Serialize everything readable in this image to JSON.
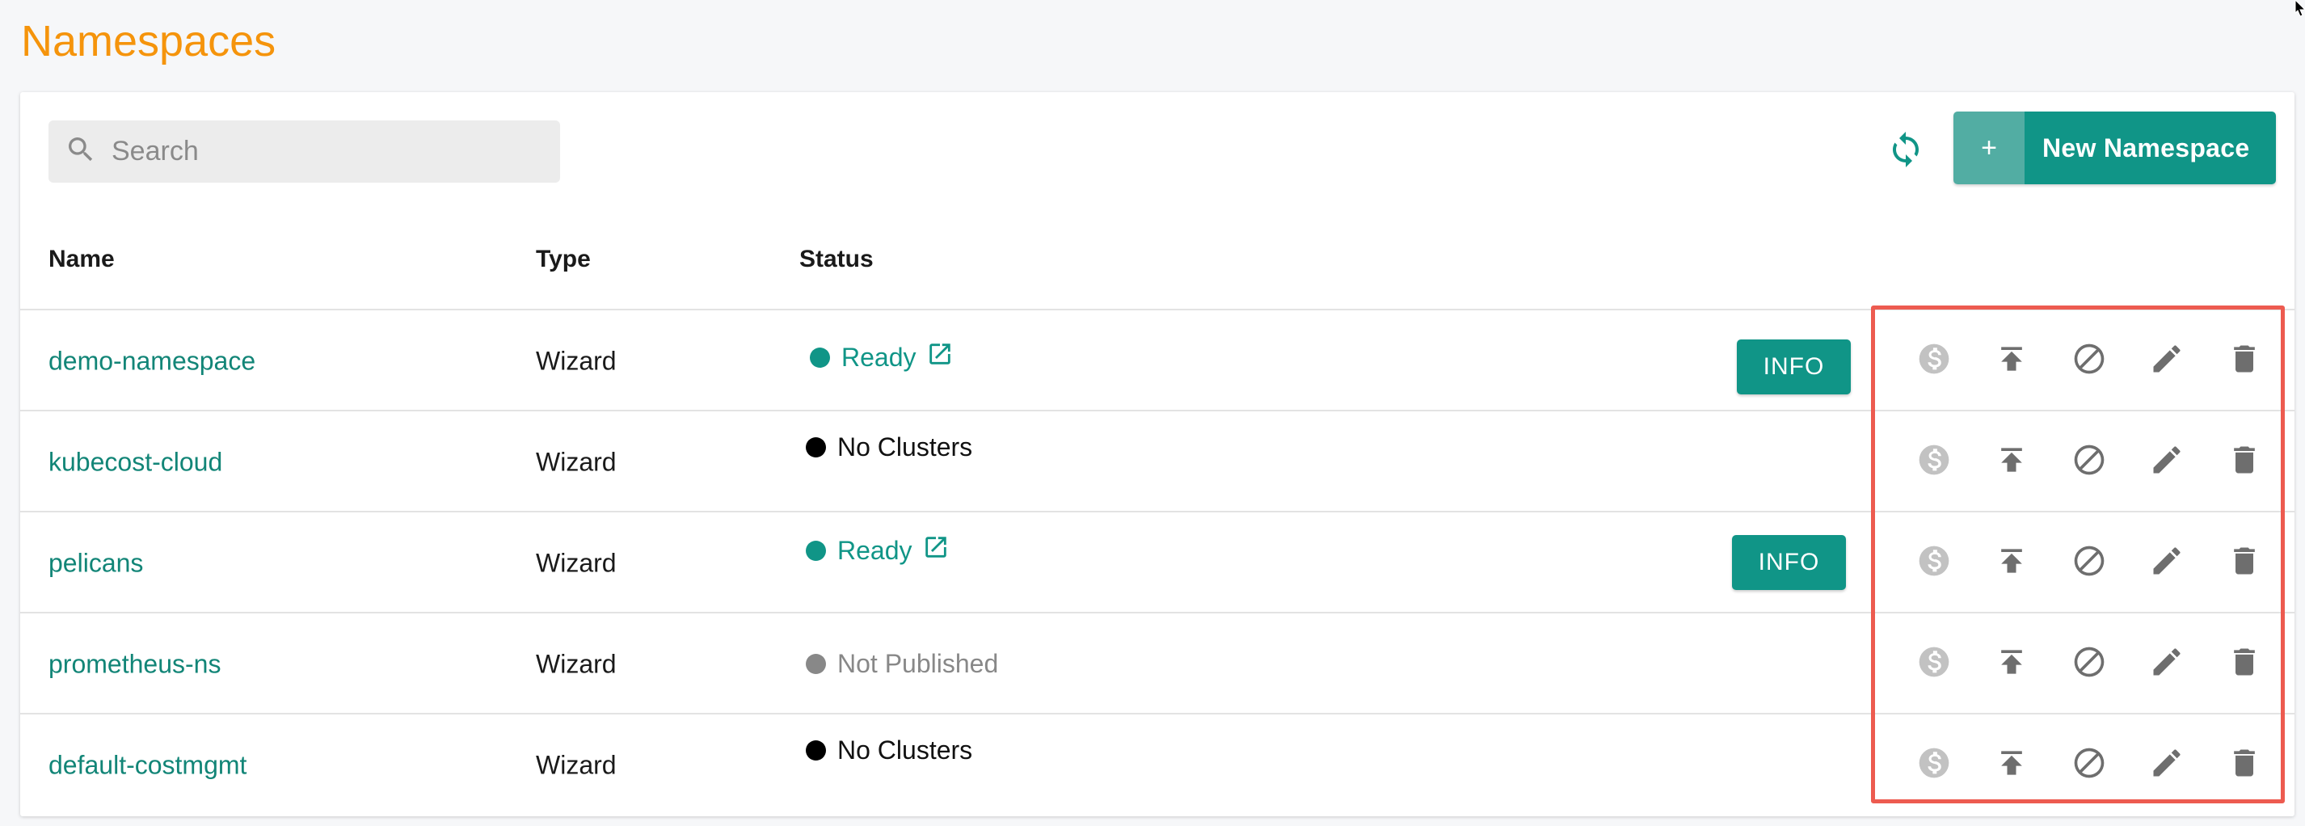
{
  "page": {
    "title": "Namespaces"
  },
  "toolbar": {
    "search_placeholder": "Search",
    "new_namespace_plus": "+",
    "new_namespace_label": "New Namespace"
  },
  "table": {
    "headers": {
      "name": "Name",
      "type": "Type",
      "status": "Status"
    },
    "rows": [
      {
        "name": "demo-namespace",
        "type": "Wizard",
        "status": "Ready",
        "status_kind": "ready",
        "info": "INFO"
      },
      {
        "name": "kubecost-cloud",
        "type": "Wizard",
        "status": "No Clusters",
        "status_kind": "noclusters",
        "info": ""
      },
      {
        "name": "pelicans",
        "type": "Wizard",
        "status": "Ready",
        "status_kind": "ready",
        "info": "INFO"
      },
      {
        "name": "prometheus-ns",
        "type": "Wizard",
        "status": "Not Published",
        "status_kind": "notpublished",
        "info": ""
      },
      {
        "name": "default-costmgmt",
        "type": "Wizard",
        "status": "No Clusters",
        "status_kind": "noclusters",
        "info": ""
      }
    ]
  },
  "row_action_icons": [
    "dollar-icon",
    "publish-icon",
    "disable-icon",
    "edit-icon",
    "delete-icon"
  ],
  "colors": {
    "title": "#f5940c",
    "accent": "#109587",
    "link": "#128577",
    "ready": "#109587",
    "no_clusters": "#000000",
    "not_published": "#888888",
    "highlight": "#ed5b50"
  }
}
